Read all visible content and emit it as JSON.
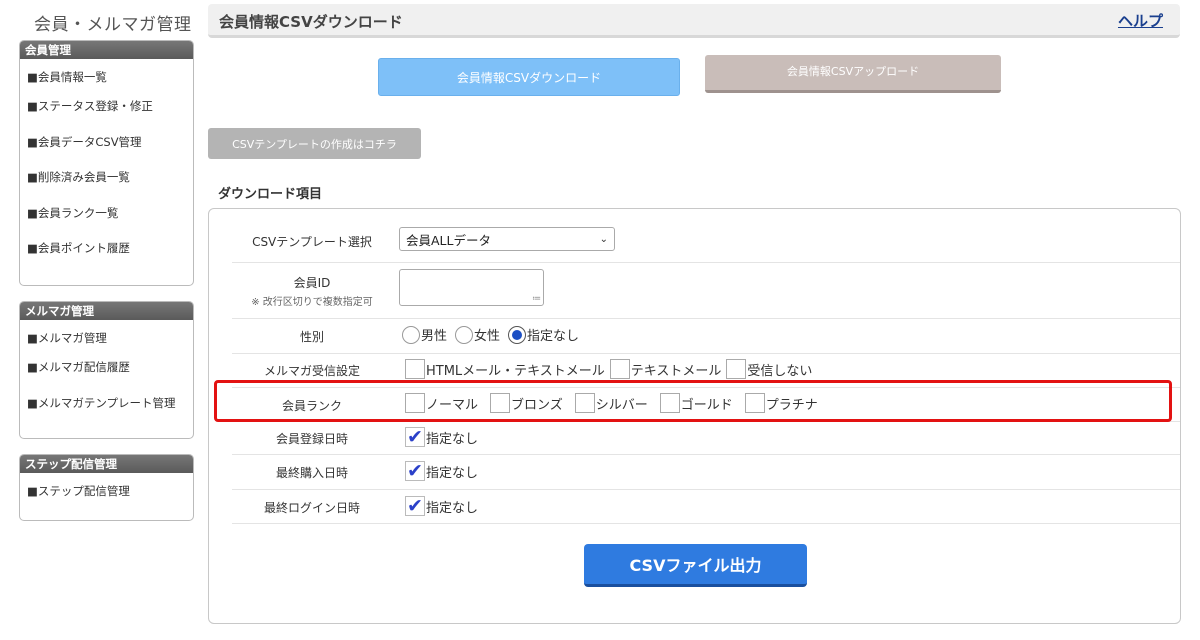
{
  "app_title": "会員・メルマガ管理",
  "sidebar": {
    "groups": [
      {
        "title": "会員管理",
        "items": [
          "■会員情報一覧",
          "■ステータス登録・修正",
          "■会員データCSV管理",
          "■削除済み会員一覧",
          "■会員ランク一覧",
          "■会員ポイント履歴"
        ]
      },
      {
        "title": "メルマガ管理",
        "items": [
          "■メルマガ管理",
          "■メルマガ配信履歴",
          "■メルマガテンプレート管理"
        ]
      },
      {
        "title": "ステップ配信管理",
        "items": [
          "■ステップ配信管理"
        ]
      }
    ]
  },
  "header": {
    "title": "会員情報CSVダウンロード",
    "help": "ヘルプ"
  },
  "tabs": {
    "download": "会員情報CSVダウンロード",
    "upload": "会員情報CSVアップロード"
  },
  "template_button": "CSVテンプレートの作成はコチラ",
  "section_title": "ダウンロード項目",
  "form": {
    "template": {
      "label": "CSVテンプレート選択",
      "value": "会員ALLデータ"
    },
    "member_id": {
      "label": "会員ID",
      "note": "※ 改行区切りで複数指定可",
      "value": ""
    },
    "gender": {
      "label": "性別",
      "options": [
        "男性",
        "女性",
        "指定なし"
      ],
      "selected": "指定なし"
    },
    "newsletter": {
      "label": "メルマガ受信設定",
      "options": [
        "HTMLメール・テキストメール",
        "テキストメール",
        "受信しない"
      ]
    },
    "rank": {
      "label": "会員ランク",
      "options": [
        "ノーマル",
        "ブロンズ",
        "シルバー",
        "ゴールド",
        "プラチナ"
      ]
    },
    "registered": {
      "label": "会員登録日時",
      "option": "指定なし",
      "checked": true
    },
    "last_purchase": {
      "label": "最終購入日時",
      "option": "指定なし",
      "checked": true
    },
    "last_login": {
      "label": "最終ログイン日時",
      "option": "指定なし",
      "checked": true
    }
  },
  "submit": "CSVファイル出力",
  "colors": {
    "accent": "#2f7be0",
    "highlight": "#e31212",
    "tab_active": "#7ec0f8",
    "tab_inactive": "#c9bdb9"
  },
  "icons": {
    "select": "chevron-down-icon",
    "check": "checkmark-icon"
  }
}
